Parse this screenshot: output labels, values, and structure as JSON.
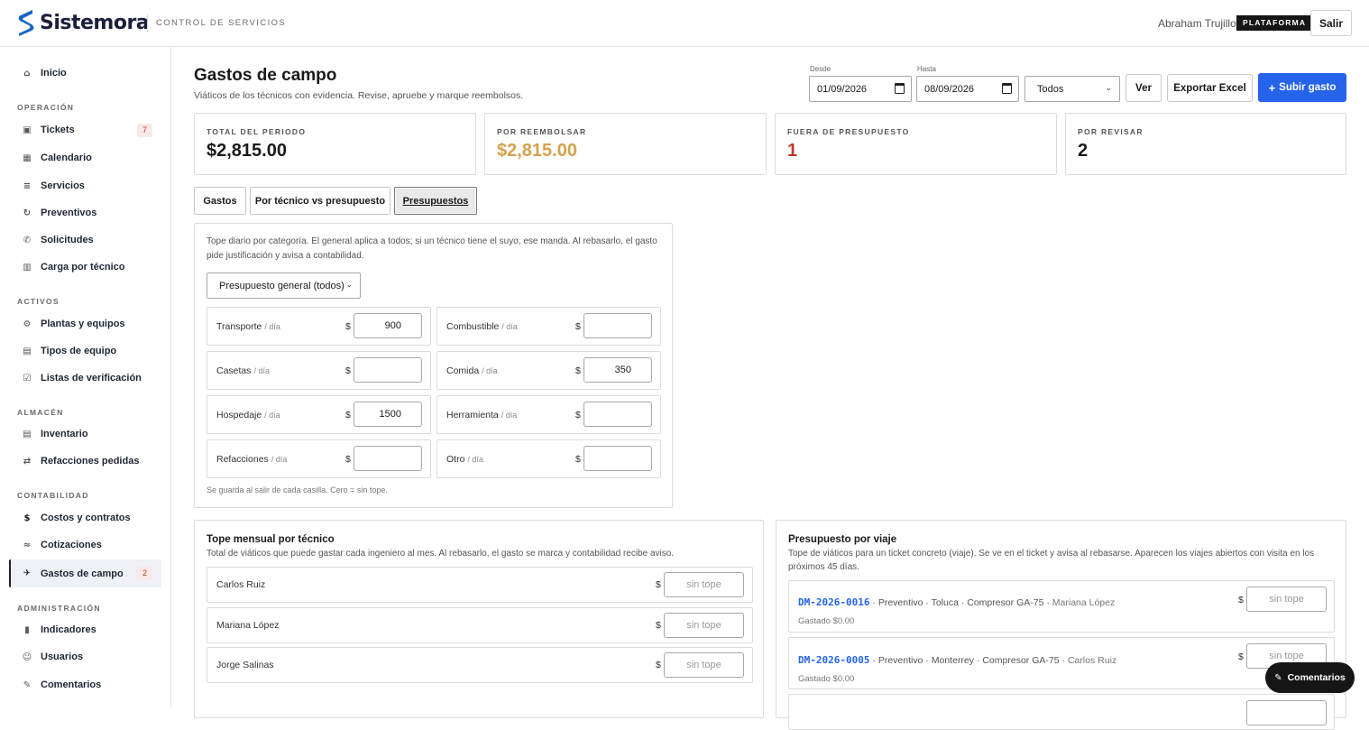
{
  "header": {
    "logo_text": "Sistemora",
    "app_subtitle": "CONTROL DE SERVICIOS",
    "user_name": "Abraham Trujillo",
    "platform_badge": "PLATAFORMA",
    "logout_label": "Salir",
    "brand_color": "#1565c0"
  },
  "sidebar": {
    "home": {
      "label": "Inicio",
      "icon": "home-icon"
    },
    "sections": [
      {
        "title": "OPERACIÓN",
        "items": [
          {
            "label": "Tickets",
            "icon": "ticket-icon",
            "count": "7"
          },
          {
            "label": "Calendario",
            "icon": "calendar-icon"
          },
          {
            "label": "Servicios",
            "icon": "list-icon"
          },
          {
            "label": "Preventivos",
            "icon": "refresh-icon"
          },
          {
            "label": "Solicitudes",
            "icon": "request-icon"
          },
          {
            "label": "Carga por técnico",
            "icon": "workload-icon"
          }
        ]
      },
      {
        "title": "ACTIVOS",
        "items": [
          {
            "label": "Plantas y equipos",
            "icon": "gear-icon"
          },
          {
            "label": "Tipos de equipo",
            "icon": "equipment-type-icon"
          },
          {
            "label": "Listas de verificación",
            "icon": "checklist-icon"
          }
        ]
      },
      {
        "title": "ALMACÉN",
        "items": [
          {
            "label": "Inventario",
            "icon": "inventory-icon"
          },
          {
            "label": "Refacciones pedidas",
            "icon": "transfer-icon"
          }
        ]
      },
      {
        "title": "CONTABILIDAD",
        "items": [
          {
            "label": "Costos y contratos",
            "icon": "dollar-icon"
          },
          {
            "label": "Cotizaciones",
            "icon": "quote-icon"
          },
          {
            "label": "Gastos de campo",
            "icon": "plane-icon",
            "count": "2",
            "active": true
          }
        ]
      },
      {
        "title": "ADMINISTRACIÓN",
        "items": [
          {
            "label": "Indicadores",
            "icon": "indicator-icon"
          },
          {
            "label": "Usuarios",
            "icon": "user-icon"
          },
          {
            "label": "Comentarios",
            "icon": "pencil-icon"
          }
        ]
      }
    ]
  },
  "page": {
    "title": "Gastos de campo",
    "subtitle": "Viáticos de los técnicos con evidencia. Revise, apruebe y marque reembolsos."
  },
  "filters": {
    "from_label": "Desde",
    "from_value": "01/09/2026",
    "to_label": "Hasta",
    "to_value": "08/09/2026",
    "status_value": "Todos",
    "view_label": "Ver",
    "export_label": "Exportar Excel",
    "upload_label": "Subir gasto"
  },
  "stats": [
    {
      "label": "TOTAL DEL PERIODO",
      "value": "$2,815.00",
      "color": "#1a1a1a"
    },
    {
      "label": "POR REEMBOLSAR",
      "value": "$2,815.00",
      "color": "#d4a24c"
    },
    {
      "label": "FUERA DE PRESUPUESTO",
      "value": "1",
      "color": "#c0392b"
    },
    {
      "label": "POR REVISAR",
      "value": "2",
      "color": "#1a1a1a"
    }
  ],
  "tabs": [
    {
      "label": "Gastos"
    },
    {
      "label": "Por técnico vs presupuesto"
    },
    {
      "label": "Presupuestos",
      "active": true
    }
  ],
  "daily_caps": {
    "note": "Tope diario por categoría. El general aplica a todos; si un técnico tiene el suyo, ese manda. Al rebasarlo, el gasto pide justificación y avisa a contabilidad.",
    "selector_value": "Presupuesto general (todos)",
    "unit": "/ día",
    "currency": "$",
    "categories": [
      {
        "label": "Transporte",
        "value": "900"
      },
      {
        "label": "Combustible",
        "value": ""
      },
      {
        "label": "Casetas",
        "value": ""
      },
      {
        "label": "Comida",
        "value": "350"
      },
      {
        "label": "Hospedaje",
        "value": "1500"
      },
      {
        "label": "Herramienta",
        "value": ""
      },
      {
        "label": "Refacciones",
        "value": ""
      },
      {
        "label": "Otro",
        "value": ""
      }
    ],
    "footer": "Se guarda al salir de cada casilla. Cero = sin tope."
  },
  "monthly_caps": {
    "title": "Tope mensual por técnico",
    "note": "Total de viáticos que puede gastar cada ingeniero al mes. Al rebasarlo, el gasto se marca y contabilidad recibe aviso.",
    "currency": "$",
    "placeholder": "sin tope",
    "technicians": [
      {
        "name": "Carlos Ruiz"
      },
      {
        "name": "Mariana López"
      },
      {
        "name": "Jorge Salinas"
      }
    ]
  },
  "trip_budget": {
    "title": "Presupuesto por viaje",
    "note": "Tope de viáticos para un ticket concreto (viaje). Se ve en el ticket y avisa al rebasarse. Aparecen los viajes abiertos con visita en los próximos 45 días.",
    "currency": "$",
    "placeholder": "sin tope",
    "trips": [
      {
        "id": "DM-2026-0016",
        "meta": " · Preventivo · Toluca · Compresor GA-75 · ",
        "tech": "Mariana López",
        "spent": "Gastado $0.00"
      },
      {
        "id": "DM-2026-0005",
        "meta": " · Preventivo · Monterrey · Compresor GA-75 · ",
        "tech": "Carlos Ruiz",
        "spent": "Gastado $0.00"
      }
    ]
  },
  "feedback_button": {
    "label": "Comentarios",
    "icon": "pencil-icon"
  }
}
